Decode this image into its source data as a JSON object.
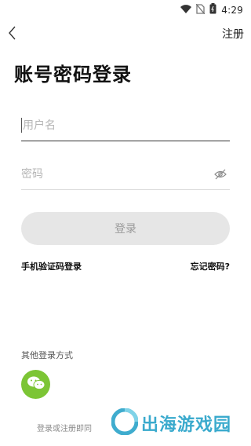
{
  "status_bar": {
    "time": "4:29"
  },
  "nav": {
    "register_label": "注册"
  },
  "page": {
    "title": "账号密码登录"
  },
  "form": {
    "username_placeholder": "用户名",
    "password_placeholder": "密码",
    "login_label": "登录",
    "sms_login_label": "手机验证码登录",
    "forgot_label": "忘记密码?"
  },
  "other_login": {
    "label": "其他登录方式",
    "wechat_icon": "wechat-icon"
  },
  "footer": {
    "agreement_text": "登录或注册即同"
  },
  "watermark": {
    "text": "出海游戏园"
  },
  "colors": {
    "wechat_green": "#7cc535",
    "button_disabled_bg": "#e6e6e6",
    "watermark": "#2aa3c9"
  }
}
